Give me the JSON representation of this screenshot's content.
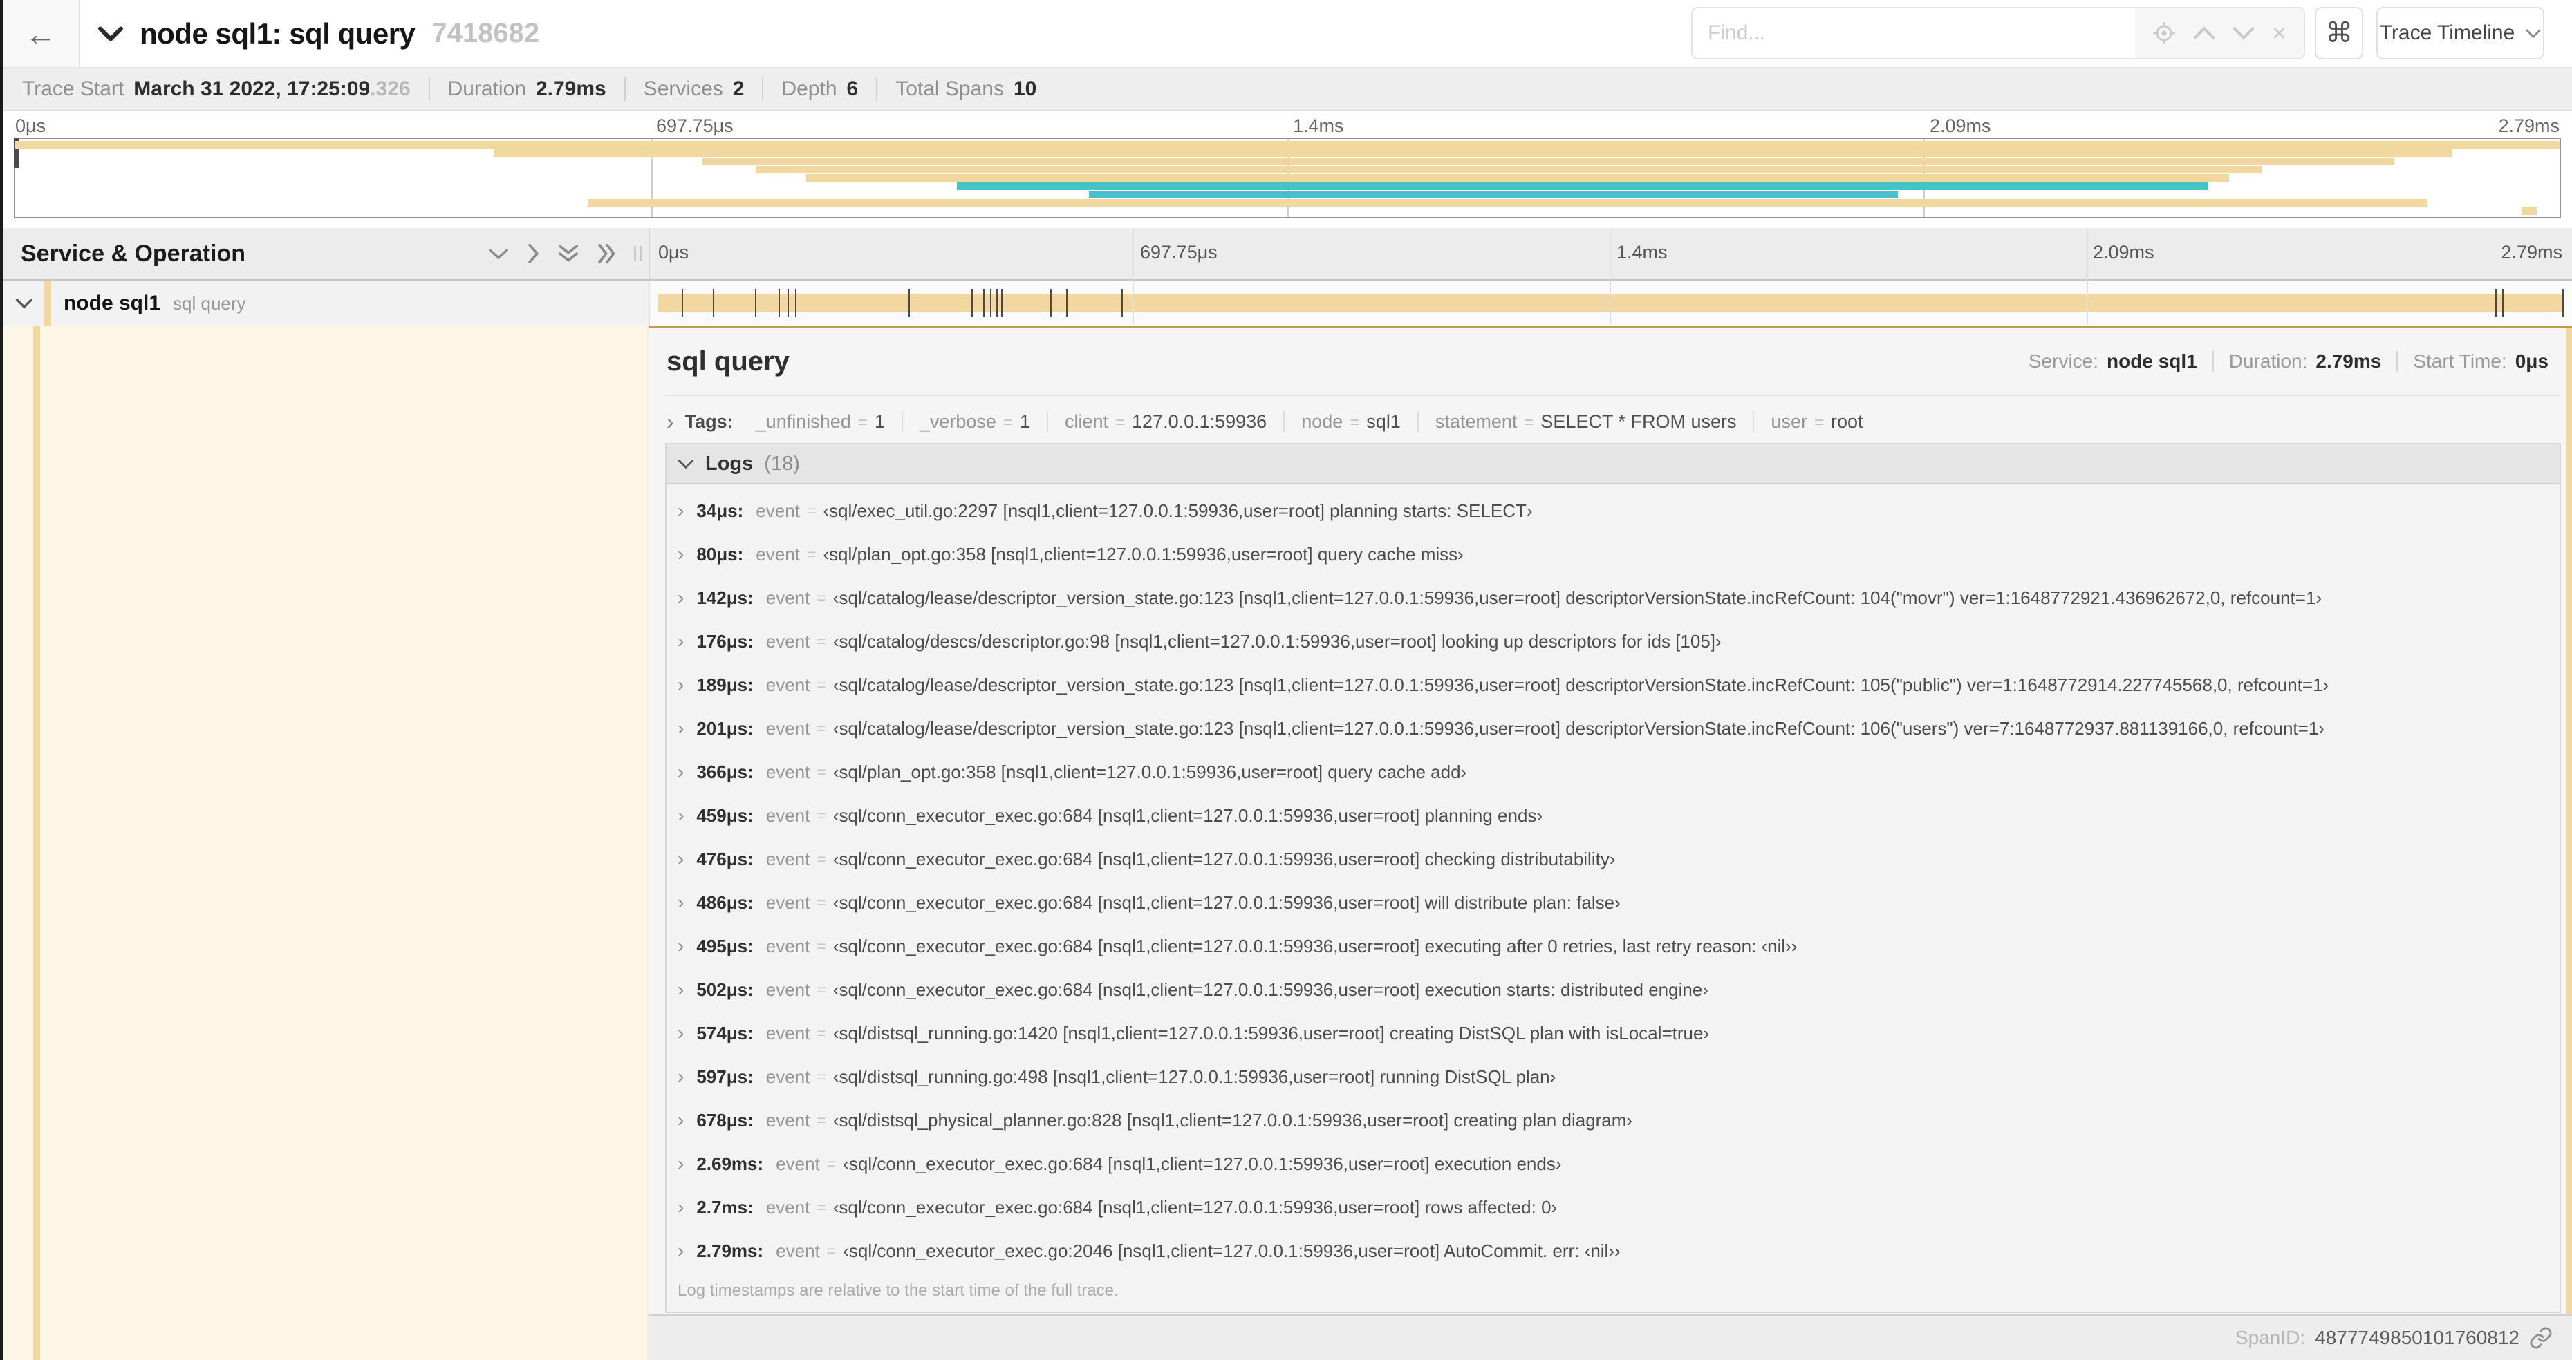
{
  "icons": {
    "back": "←",
    "clear": "×",
    "expander": "›",
    "shortcut": "⌘"
  },
  "header": {
    "title": "node sql1: sql query",
    "trace_id": "7418682",
    "find_placeholder": "Find...",
    "view_button": "Trace Timeline"
  },
  "summary": {
    "items": [
      {
        "label": "Trace Start",
        "value": "March 31 2022, 17:25:09",
        "suffix": ".326"
      },
      {
        "label": "Duration",
        "value": "2.79ms"
      },
      {
        "label": "Services",
        "value": "2"
      },
      {
        "label": "Depth",
        "value": "6"
      },
      {
        "label": "Total Spans",
        "value": "10"
      }
    ]
  },
  "minimap": {
    "ticks": [
      {
        "label": "0μs",
        "pos": 0
      },
      {
        "label": "697.75μs",
        "pos": 25
      },
      {
        "label": "1.4ms",
        "pos": 50
      },
      {
        "label": "2.09ms",
        "pos": 75
      },
      {
        "label": "2.79ms",
        "pos": 100
      }
    ],
    "spans": [
      {
        "start": 0.0,
        "end": 1.0,
        "color": "tan",
        "row": 0
      },
      {
        "start": 0.188,
        "end": 0.958,
        "color": "tan",
        "row": 1
      },
      {
        "start": 0.27,
        "end": 0.935,
        "color": "tan",
        "row": 2
      },
      {
        "start": 0.291,
        "end": 0.883,
        "color": "tan",
        "row": 3
      },
      {
        "start": 0.311,
        "end": 0.87,
        "color": "tan",
        "row": 4
      },
      {
        "start": 0.37,
        "end": 0.862,
        "color": "teal",
        "row": 5
      },
      {
        "start": 0.422,
        "end": 0.74,
        "color": "teal",
        "row": 6
      },
      {
        "start": 0.225,
        "end": 0.948,
        "color": "tan",
        "row": 7
      },
      {
        "start": 0.985,
        "end": 0.991,
        "color": "tan",
        "row": 8
      }
    ]
  },
  "grid": {
    "left_header": "Service & Operation"
  },
  "span_row": {
    "service": "node sql1",
    "operation": "sql query",
    "log_ticks": [
      1.22,
      2.87,
      5.09,
      6.31,
      6.77,
      7.2,
      13.12,
      16.45,
      17.06,
      17.42,
      17.74,
      18.0,
      20.57,
      21.4,
      24.3,
      96.42,
      96.77,
      99.93
    ]
  },
  "detail": {
    "operation": "sql query",
    "service_label": "Service:",
    "service": "node sql1",
    "duration_label": "Duration:",
    "duration": "2.79ms",
    "start_label": "Start Time:",
    "start": "0μs",
    "tags_label": "Tags:",
    "eq": "=",
    "log_key": "event",
    "tags": [
      {
        "key": "_unfinished",
        "value": "1"
      },
      {
        "key": "_verbose",
        "value": "1"
      },
      {
        "key": "client",
        "value": "127.0.0.1:59936"
      },
      {
        "key": "node",
        "value": "sql1"
      },
      {
        "key": "statement",
        "value": "SELECT * FROM users"
      },
      {
        "key": "user",
        "value": "root"
      }
    ],
    "logs_label": "Logs",
    "logs_count": "(18)",
    "logs": [
      {
        "time": "34μs:",
        "value": "‹sql/exec_util.go:2297 [nsql1,client=127.0.0.1:59936,user=root] planning starts: SELECT›"
      },
      {
        "time": "80μs:",
        "value": "‹sql/plan_opt.go:358 [nsql1,client=127.0.0.1:59936,user=root] query cache miss›"
      },
      {
        "time": "142μs:",
        "value": "‹sql/catalog/lease/descriptor_version_state.go:123 [nsql1,client=127.0.0.1:59936,user=root] descriptorVersionState.incRefCount: 104(\"movr\") ver=1:1648772921.436962672,0, refcount=1›"
      },
      {
        "time": "176μs:",
        "value": "‹sql/catalog/descs/descriptor.go:98 [nsql1,client=127.0.0.1:59936,user=root] looking up descriptors for ids [105]›"
      },
      {
        "time": "189μs:",
        "value": "‹sql/catalog/lease/descriptor_version_state.go:123 [nsql1,client=127.0.0.1:59936,user=root] descriptorVersionState.incRefCount: 105(\"public\") ver=1:1648772914.227745568,0, refcount=1›"
      },
      {
        "time": "201μs:",
        "value": "‹sql/catalog/lease/descriptor_version_state.go:123 [nsql1,client=127.0.0.1:59936,user=root] descriptorVersionState.incRefCount: 106(\"users\") ver=7:1648772937.881139166,0, refcount=1›"
      },
      {
        "time": "366μs:",
        "value": "‹sql/plan_opt.go:358 [nsql1,client=127.0.0.1:59936,user=root] query cache add›"
      },
      {
        "time": "459μs:",
        "value": "‹sql/conn_executor_exec.go:684 [nsql1,client=127.0.0.1:59936,user=root] planning ends›"
      },
      {
        "time": "476μs:",
        "value": "‹sql/conn_executor_exec.go:684 [nsql1,client=127.0.0.1:59936,user=root] checking distributability›"
      },
      {
        "time": "486μs:",
        "value": "‹sql/conn_executor_exec.go:684 [nsql1,client=127.0.0.1:59936,user=root] will distribute plan: false›"
      },
      {
        "time": "495μs:",
        "value": "‹sql/conn_executor_exec.go:684 [nsql1,client=127.0.0.1:59936,user=root] executing after 0 retries, last retry reason: ‹nil››"
      },
      {
        "time": "502μs:",
        "value": "‹sql/conn_executor_exec.go:684 [nsql1,client=127.0.0.1:59936,user=root] execution starts: distributed engine›"
      },
      {
        "time": "574μs:",
        "value": "‹sql/distsql_running.go:1420 [nsql1,client=127.0.0.1:59936,user=root] creating DistSQL plan with isLocal=true›"
      },
      {
        "time": "597μs:",
        "value": "‹sql/distsql_running.go:498 [nsql1,client=127.0.0.1:59936,user=root] running DistSQL plan›"
      },
      {
        "time": "678μs:",
        "value": "‹sql/distsql_physical_planner.go:828 [nsql1,client=127.0.0.1:59936,user=root] creating plan diagram›"
      },
      {
        "time": "2.69ms:",
        "value": "‹sql/conn_executor_exec.go:684 [nsql1,client=127.0.0.1:59936,user=root] execution ends›"
      },
      {
        "time": "2.7ms:",
        "value": "‹sql/conn_executor_exec.go:684 [nsql1,client=127.0.0.1:59936,user=root] rows affected: 0›"
      },
      {
        "time": "2.79ms:",
        "value": "‹sql/conn_executor_exec.go:2046 [nsql1,client=127.0.0.1:59936,user=root] AutoCommit. err: ‹nil››"
      }
    ],
    "logs_note": "Log timestamps are relative to the start time of the full trace.",
    "span_id_label": "SpanID:",
    "span_id": "4877749850101760812"
  },
  "colors": {
    "tan": "#f2d7a0",
    "teal": "#45c3c9",
    "cream": "#fdf6e5",
    "detail_border": "#c09a52"
  }
}
